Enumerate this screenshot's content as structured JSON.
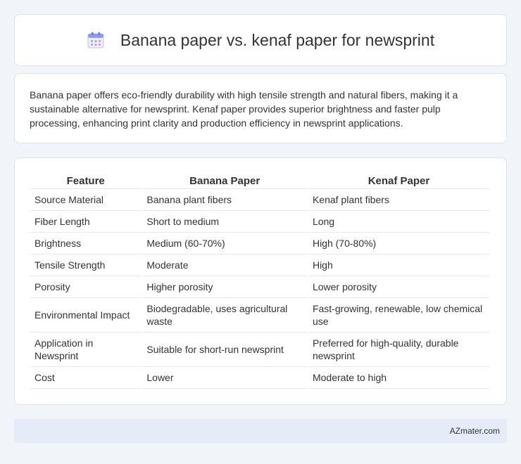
{
  "header": {
    "title": "Banana paper vs. kenaf paper for newsprint",
    "icon": "calendar-icon"
  },
  "intro": {
    "text": "Banana paper offers eco-friendly durability with high tensile strength and natural fibers, making it a sustainable alternative for newsprint. Kenaf paper provides superior brightness and faster pulp processing, enhancing print clarity and production efficiency in newsprint applications."
  },
  "table": {
    "headers": [
      "Feature",
      "Banana Paper",
      "Kenaf Paper"
    ],
    "rows": [
      [
        "Source Material",
        "Banana plant fibers",
        "Kenaf plant fibers"
      ],
      [
        "Fiber Length",
        "Short to medium",
        "Long"
      ],
      [
        "Brightness",
        "Medium (60-70%)",
        "High (70-80%)"
      ],
      [
        "Tensile Strength",
        "Moderate",
        "High"
      ],
      [
        "Porosity",
        "Higher porosity",
        "Lower porosity"
      ],
      [
        "Environmental Impact",
        "Biodegradable, uses agricultural waste",
        "Fast-growing, renewable, low chemical use"
      ],
      [
        "Application in Newsprint",
        "Suitable for short-run newsprint",
        "Preferred for high-quality, durable newsprint"
      ],
      [
        "Cost",
        "Lower",
        "Moderate to high"
      ]
    ]
  },
  "footer": {
    "brand": "AZmater.com"
  }
}
